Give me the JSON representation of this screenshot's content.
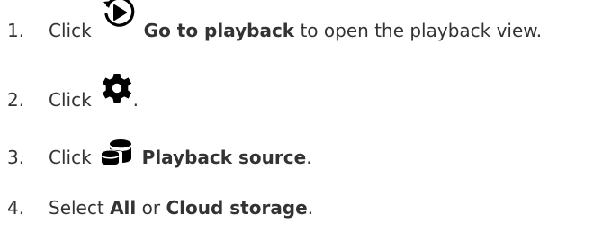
{
  "steps": [
    {
      "number": "1.",
      "pre": "Click",
      "icon": "playback-icon",
      "bold": "Go to playback",
      "post": " to open the playback view."
    },
    {
      "number": "2.",
      "pre": "Click",
      "icon": "gear-icon",
      "post": "."
    },
    {
      "number": "3.",
      "pre": "Click",
      "icon": "database-icon",
      "bold": "Playback source",
      "post": "."
    },
    {
      "number": "4.",
      "pre": "Select ",
      "bold1": "All",
      "mid": " or ",
      "bold2": "Cloud storage",
      "post": "."
    }
  ],
  "colors": {
    "text": "#333333",
    "icon": "#000000"
  }
}
